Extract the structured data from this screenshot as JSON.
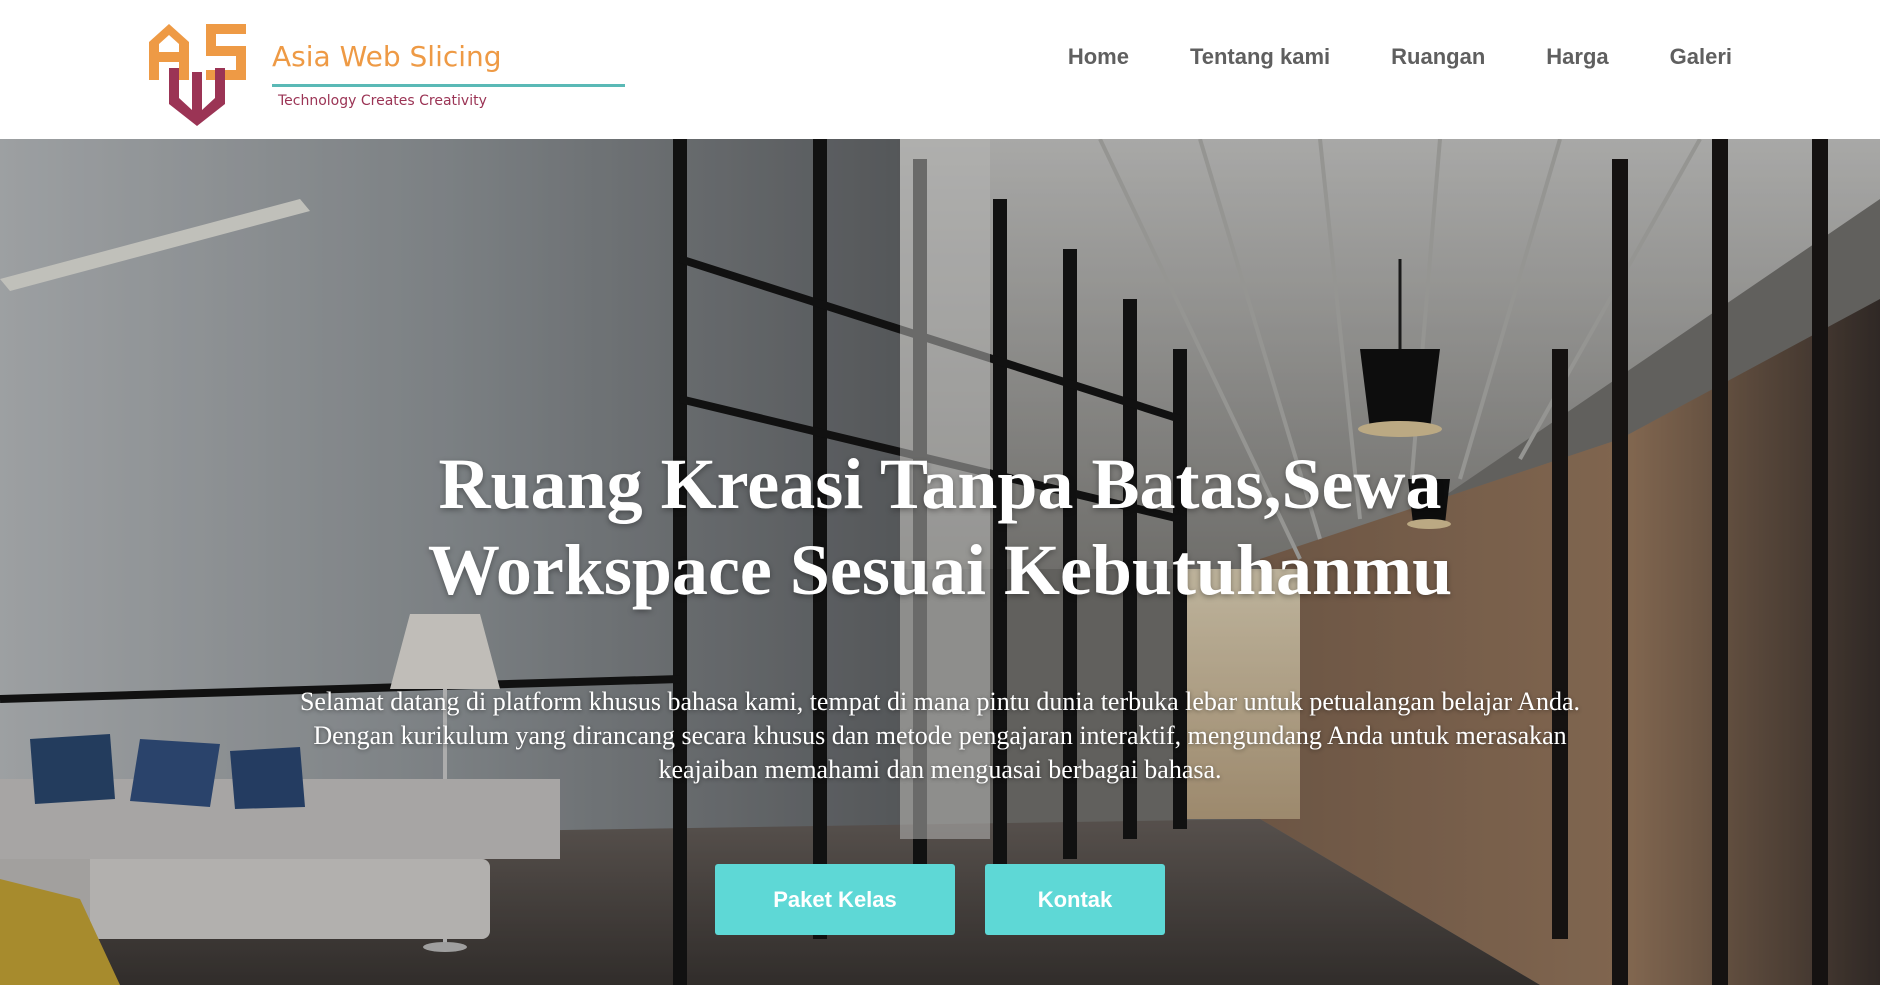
{
  "brand": {
    "name": "Asia Web Slicing",
    "tagline": "Technology Creates Creativity",
    "colors": {
      "orange": "#ee9a45",
      "maroon": "#9b3455",
      "teal": "#5ab9b6"
    }
  },
  "nav": {
    "items": [
      {
        "label": "Home"
      },
      {
        "label": "Tentang kami"
      },
      {
        "label": "Ruangan"
      },
      {
        "label": "Harga"
      },
      {
        "label": "Galeri"
      }
    ]
  },
  "hero": {
    "title": "Ruang Kreasi Tanpa Batas,Sewa Workspace Sesuai Kebutuhanmu",
    "description": "Selamat datang di platform khusus bahasa kami, tempat di mana pintu dunia terbuka lebar untuk petualangan belajar Anda. Dengan kurikulum yang dirancang secara khusus dan metode pengajaran interaktif, mengundang Anda untuk merasakan keajaiban memahami dan menguasai berbagai bahasa.",
    "background": "office-corridor-photo",
    "buttons": {
      "primary_label": "Paket Kelas",
      "secondary_label": "Kontak",
      "color": "#5ed8d6"
    }
  }
}
